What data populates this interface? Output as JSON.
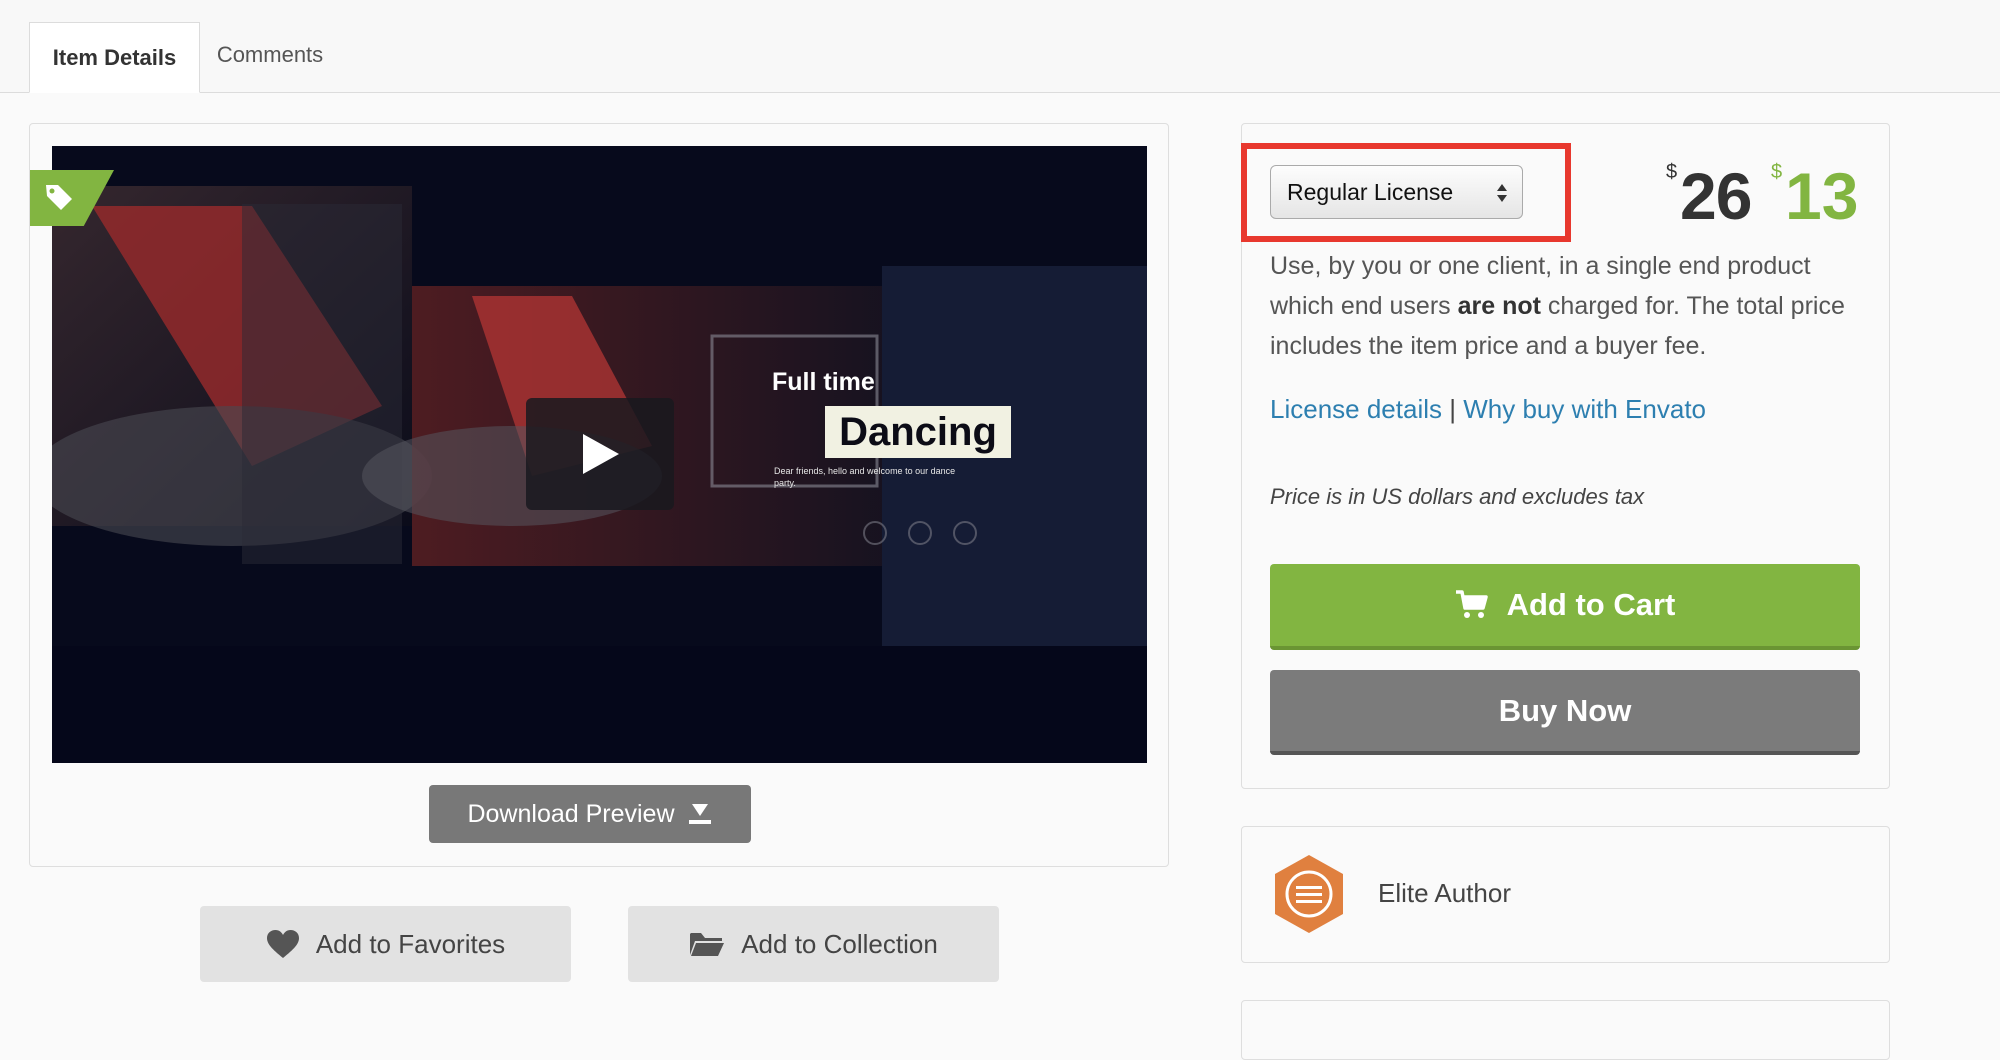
{
  "tabs": [
    {
      "label": "Item Details",
      "active": true
    },
    {
      "label": "Comments",
      "active": false
    }
  ],
  "preview": {
    "video_title_line1": "Full time",
    "video_title_line2": "Dancing",
    "video_subtitle": "Dear friends, hello and welcome to our dance party.",
    "download_label": "Download Preview"
  },
  "actions": {
    "favorites_label": "Add to Favorites",
    "collection_label": "Add to Collection"
  },
  "license": {
    "selected": "Regular License",
    "currency_symbol": "$",
    "price_old": "26",
    "price_new": "13",
    "desc_part1": "Use, by you or one client, in a single end product which end users ",
    "desc_bold": "are not",
    "desc_part2": " charged for. The total price includes the item price and a buyer fee.",
    "link_details": "License details",
    "link_separator": "|",
    "link_why": "Why buy with Envato",
    "tax_note": "Price is in US dollars and excludes tax",
    "cart_label": "Add to Cart",
    "buy_label": "Buy Now"
  },
  "author": {
    "label": "Elite Author"
  },
  "colors": {
    "accent_green": "#82b541",
    "link_blue": "#2d7fb0",
    "highlight_red": "#e8382e",
    "author_orange": "#e0803f"
  }
}
